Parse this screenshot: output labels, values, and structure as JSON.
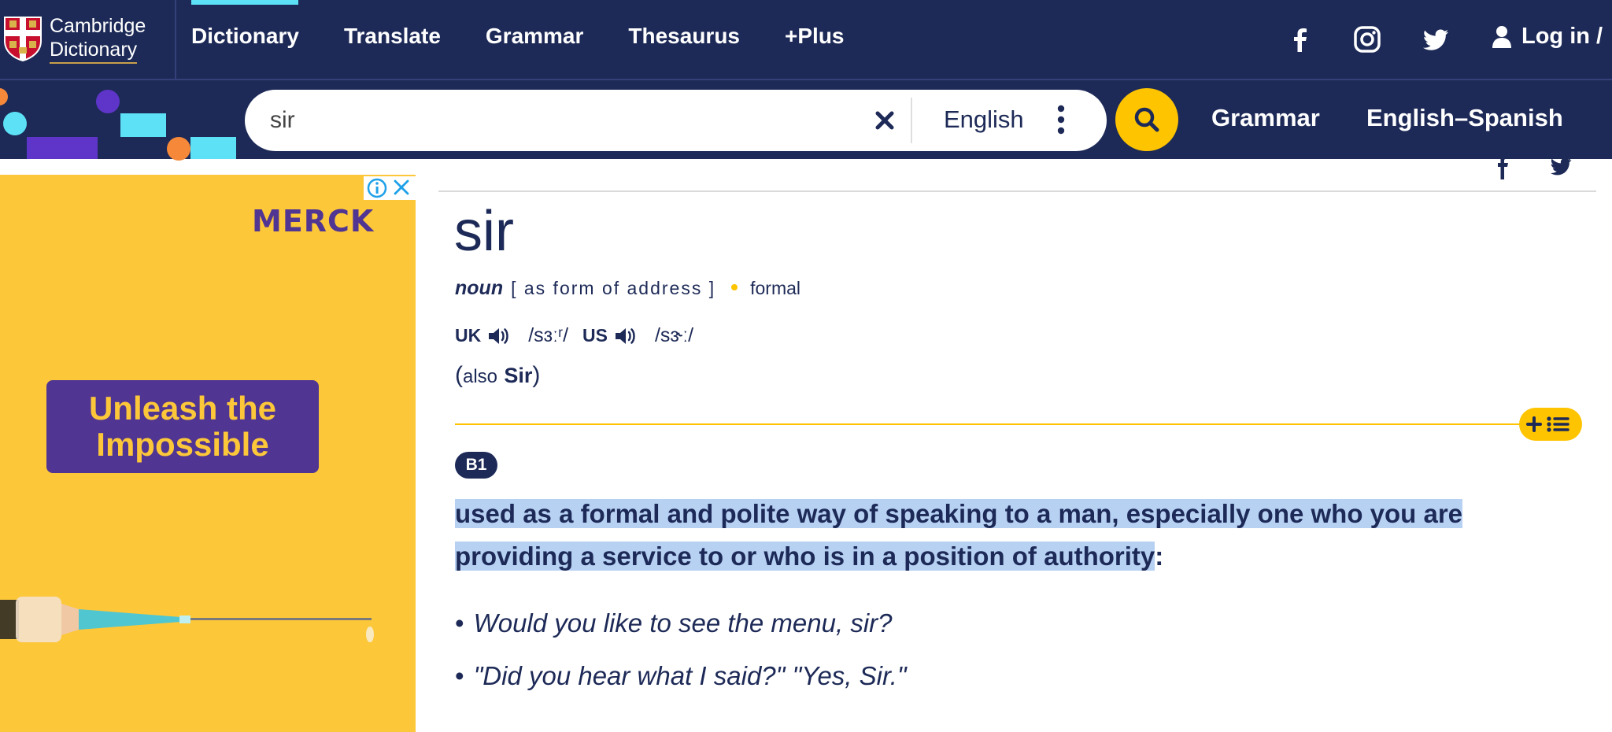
{
  "header": {
    "logo": {
      "line1": "Cambridge",
      "line2": "Dictionary"
    },
    "nav": [
      {
        "label": "Dictionary"
      },
      {
        "label": "Translate"
      },
      {
        "label": "Grammar"
      },
      {
        "label": "Thesaurus"
      },
      {
        "label": "+Plus"
      }
    ],
    "social_icons": [
      "facebook-icon",
      "instagram-icon",
      "twitter-icon"
    ],
    "login_label": "Log in /"
  },
  "search": {
    "query": "sir",
    "dictionary_select": "English",
    "links": [
      {
        "label": "Grammar"
      },
      {
        "label": "English–Spanish"
      }
    ],
    "accent_color": "#fec400",
    "brand_color": "#1d2a57"
  },
  "ad": {
    "brand": "MERCK",
    "headline_line1": "Unleash the",
    "headline_line2": "Impossible",
    "background_color": "#fdc73a",
    "cta_color": "#503592"
  },
  "entry": {
    "headword": "sir",
    "pos": "noun",
    "grammar": "[ as form of address ]",
    "usage": "formal",
    "pronunciations": [
      {
        "region": "UK",
        "ipa": "/sɜːʳ/"
      },
      {
        "region": "US",
        "ipa": "/sɝː/"
      }
    ],
    "also_open": "(",
    "also_label": "also",
    "also_variant": "Sir",
    "also_close": ")",
    "sense": {
      "level": "B1",
      "definition_highlighted": "used as a formal and polite way of speaking to a man, especially one who you are providing a service to or who is in a position of authority",
      "definition_end": ":",
      "highlight_color": "#b7d1f3",
      "examples": [
        "Would you like to see the menu, sir?",
        "\"Did you hear what I said?\" \"Yes, Sir.\""
      ]
    }
  }
}
